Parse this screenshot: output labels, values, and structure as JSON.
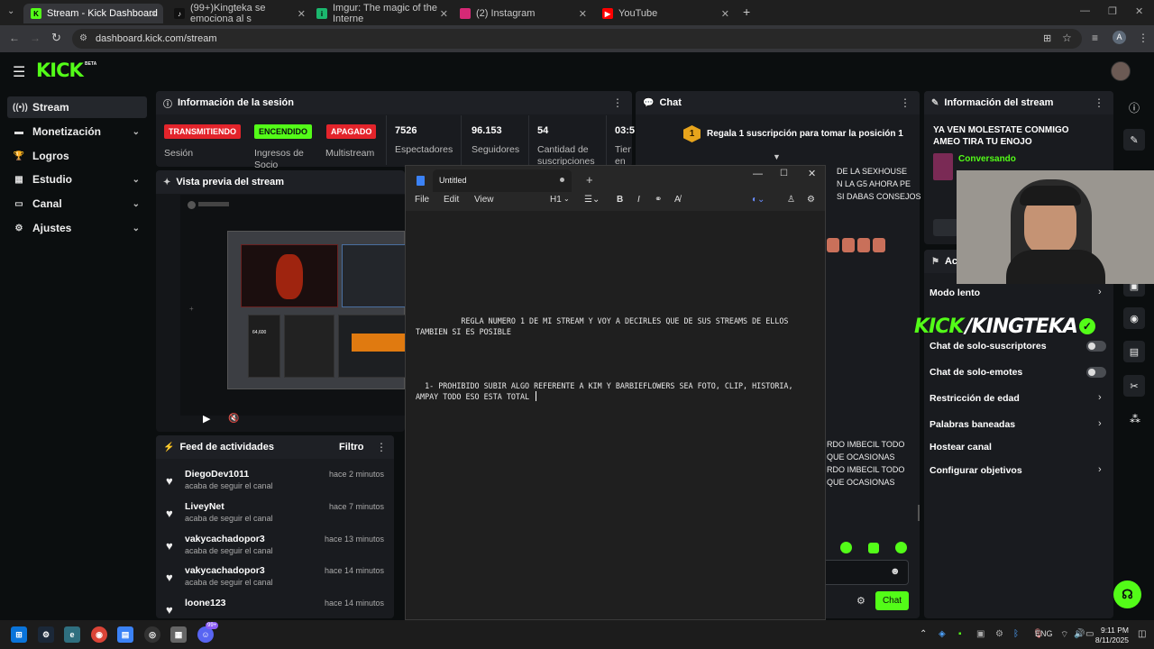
{
  "browser": {
    "tabs": [
      {
        "title": "Stream - Kick Dashboard",
        "active": true
      },
      {
        "title": "(99+)Kingteka se emociona al s"
      },
      {
        "title": "Imgur: The magic of the Interne"
      },
      {
        "title": "(2) Instagram"
      },
      {
        "title": "YouTube"
      }
    ],
    "new_tab": "+",
    "url": "dashboard.kick.com/stream",
    "profile": "A"
  },
  "kick": {
    "logo": "KICK",
    "logo_badge": "BETA"
  },
  "sidebar": {
    "items": [
      {
        "label": "Stream",
        "active": true
      },
      {
        "label": "Monetización"
      },
      {
        "label": "Logros"
      },
      {
        "label": "Estudio"
      },
      {
        "label": "Canal"
      },
      {
        "label": "Ajustes"
      }
    ]
  },
  "session": {
    "title": "Información de la sesión",
    "badges": [
      {
        "text": "TRANSMITIENDO",
        "label": "Sesión",
        "color": "#e3242b"
      },
      {
        "text": "ENCENDIDO",
        "label": "Ingresos de Socio",
        "color": "#53fc18"
      },
      {
        "text": "APAGADO",
        "label": "Multistream",
        "color": "#e3242b"
      }
    ],
    "stats": [
      {
        "value": "7526",
        "label": "Espectadores"
      },
      {
        "value": "96.153",
        "label": "Seguidores"
      },
      {
        "value": "54",
        "label": "Cantidad de suscripciones"
      },
      {
        "value": "03:5",
        "label": "Tiem en vi"
      }
    ]
  },
  "preview": {
    "title": "Vista previa del stream",
    "calc_value": "64,600"
  },
  "feed": {
    "title": "Feed de actividades",
    "filter": "Filtro",
    "items": [
      {
        "name": "DiegoDev1011",
        "action": "acaba de seguir el canal",
        "time": "hace 2 minutos"
      },
      {
        "name": "LiveyNet",
        "action": "acaba de seguir el canal",
        "time": "hace 7 minutos"
      },
      {
        "name": "vakycachadopor3",
        "action": "acaba de seguir el canal",
        "time": "hace 13 minutos"
      },
      {
        "name": "vakycachadopor3",
        "action": "acaba de seguir el canal",
        "time": "hace 14 minutos"
      },
      {
        "name": "loone123",
        "action": "",
        "time": "hace 14 minutos"
      }
    ]
  },
  "chat": {
    "title": "Chat",
    "gift_rank": "1",
    "gift_text": "Regala 1 suscripción para tomar la posición 1",
    "messages": [
      "DE LA SEXHOUSE",
      "N LA G5 AHORA PE",
      "SI DABAS CONSEJOS",
      "RDO IMBECIL TODO",
      "QUE OCASIONAS",
      "RDO IMBECIL TODO",
      "QUE OCASIONAS"
    ],
    "send": "Chat"
  },
  "notepad": {
    "tab": "Untitled",
    "menu": [
      "File",
      "Edit",
      "View"
    ],
    "heading": "H1",
    "line1": "          REGLA NUMERO 1 DE MI STREAM Y VOY A DECIRLES QUE DE SUS STREAMS DE ELLOS",
    "line2": "TAMBIEN SI ES POSIBLE",
    "line3": "  1- PROHIBIDO SUBIR ALGO REFERENTE A KIM Y BARBIEFLOWERS SEA FOTO, CLIP, HISTORIA,",
    "line4": "AMPAY TODO ESO ESTA TOTAL"
  },
  "stream_info": {
    "title": "Información del stream",
    "stream_title": "YA VEN MOLESTATE CONMIGO AMEO TIRA TU ENOJO",
    "category": "Conversando",
    "actions_title": "Acc",
    "actions": [
      {
        "label": "Modo lento",
        "kind": "chevron"
      },
      {
        "label": "Chat de solo-suscriptores",
        "kind": "toggle"
      },
      {
        "label": "Chat de solo-emotes",
        "kind": "toggle"
      },
      {
        "label": "Restricción de edad",
        "kind": "chevron"
      },
      {
        "label": "Palabras baneadas",
        "kind": "chevron"
      },
      {
        "label": "Hostear canal",
        "kind": "none"
      },
      {
        "label": "Configurar objetivos",
        "kind": "chevron"
      }
    ]
  },
  "overlay": {
    "brand_kick": "KICK",
    "brand_name": "/KINGTEKA"
  },
  "taskbar": {
    "lang": "ENG",
    "time": "9:11 PM",
    "date": "8/11/2025",
    "badge": "99+"
  }
}
